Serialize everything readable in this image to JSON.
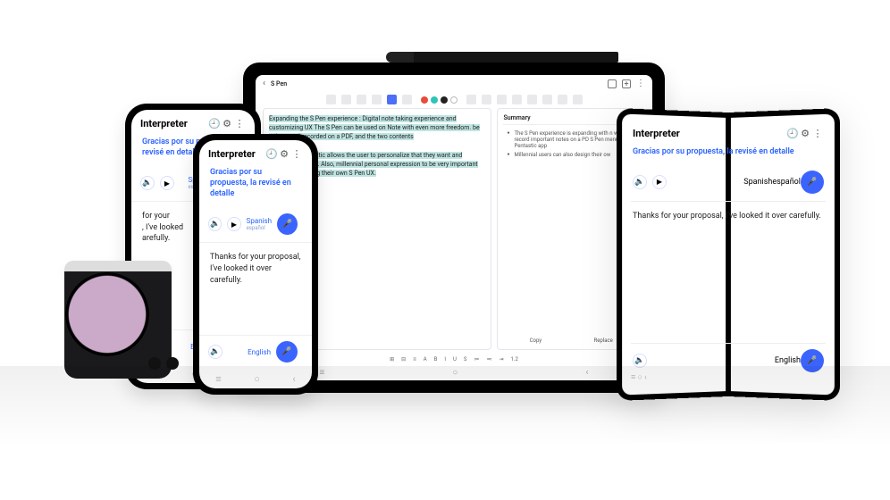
{
  "tablet": {
    "title": "S Pen",
    "paragraph1": "Expanding the S Pen experience : Digital note taking experience and customizing UX The S Pen can be used on Note with even more freedom. ",
    "paragraph1b": "be written and recorded on a PDF, and the two contents",
    "paragraph2": "app called Pentastic allows the user to personalize that they want and customize the UX. Also, millennial personal expression to be very important are afforded gning their own S Pen UX.",
    "summaryTitle": "Summary",
    "bullet1": "The S Pen experience is expanding with n write and record important notes on a PD  S Pen menu with the Pentastic app",
    "bullet2": "Millennial users can also design their ow",
    "copy": "Copy",
    "replace": "Replace",
    "fmt": [
      "⊞",
      "⊟",
      "≡",
      "A",
      "B",
      "I",
      "U",
      "S",
      "≔",
      "≕",
      "⇥",
      "1.2"
    ]
  },
  "interpreter": {
    "title": "Interpreter",
    "src_text": "Gracias por su propuesta, la revisé en detalle",
    "dst_text": "Thanks for your proposal, I've looked it over carefully.",
    "src_lang": "Spanish",
    "src_sub": "español",
    "dst_lang": "English"
  },
  "fold": {
    "src_text": "Gracias por su propuesta, la revisé en detalle",
    "dst_text": "Thanks for your proposal, I've looked it over carefully."
  }
}
